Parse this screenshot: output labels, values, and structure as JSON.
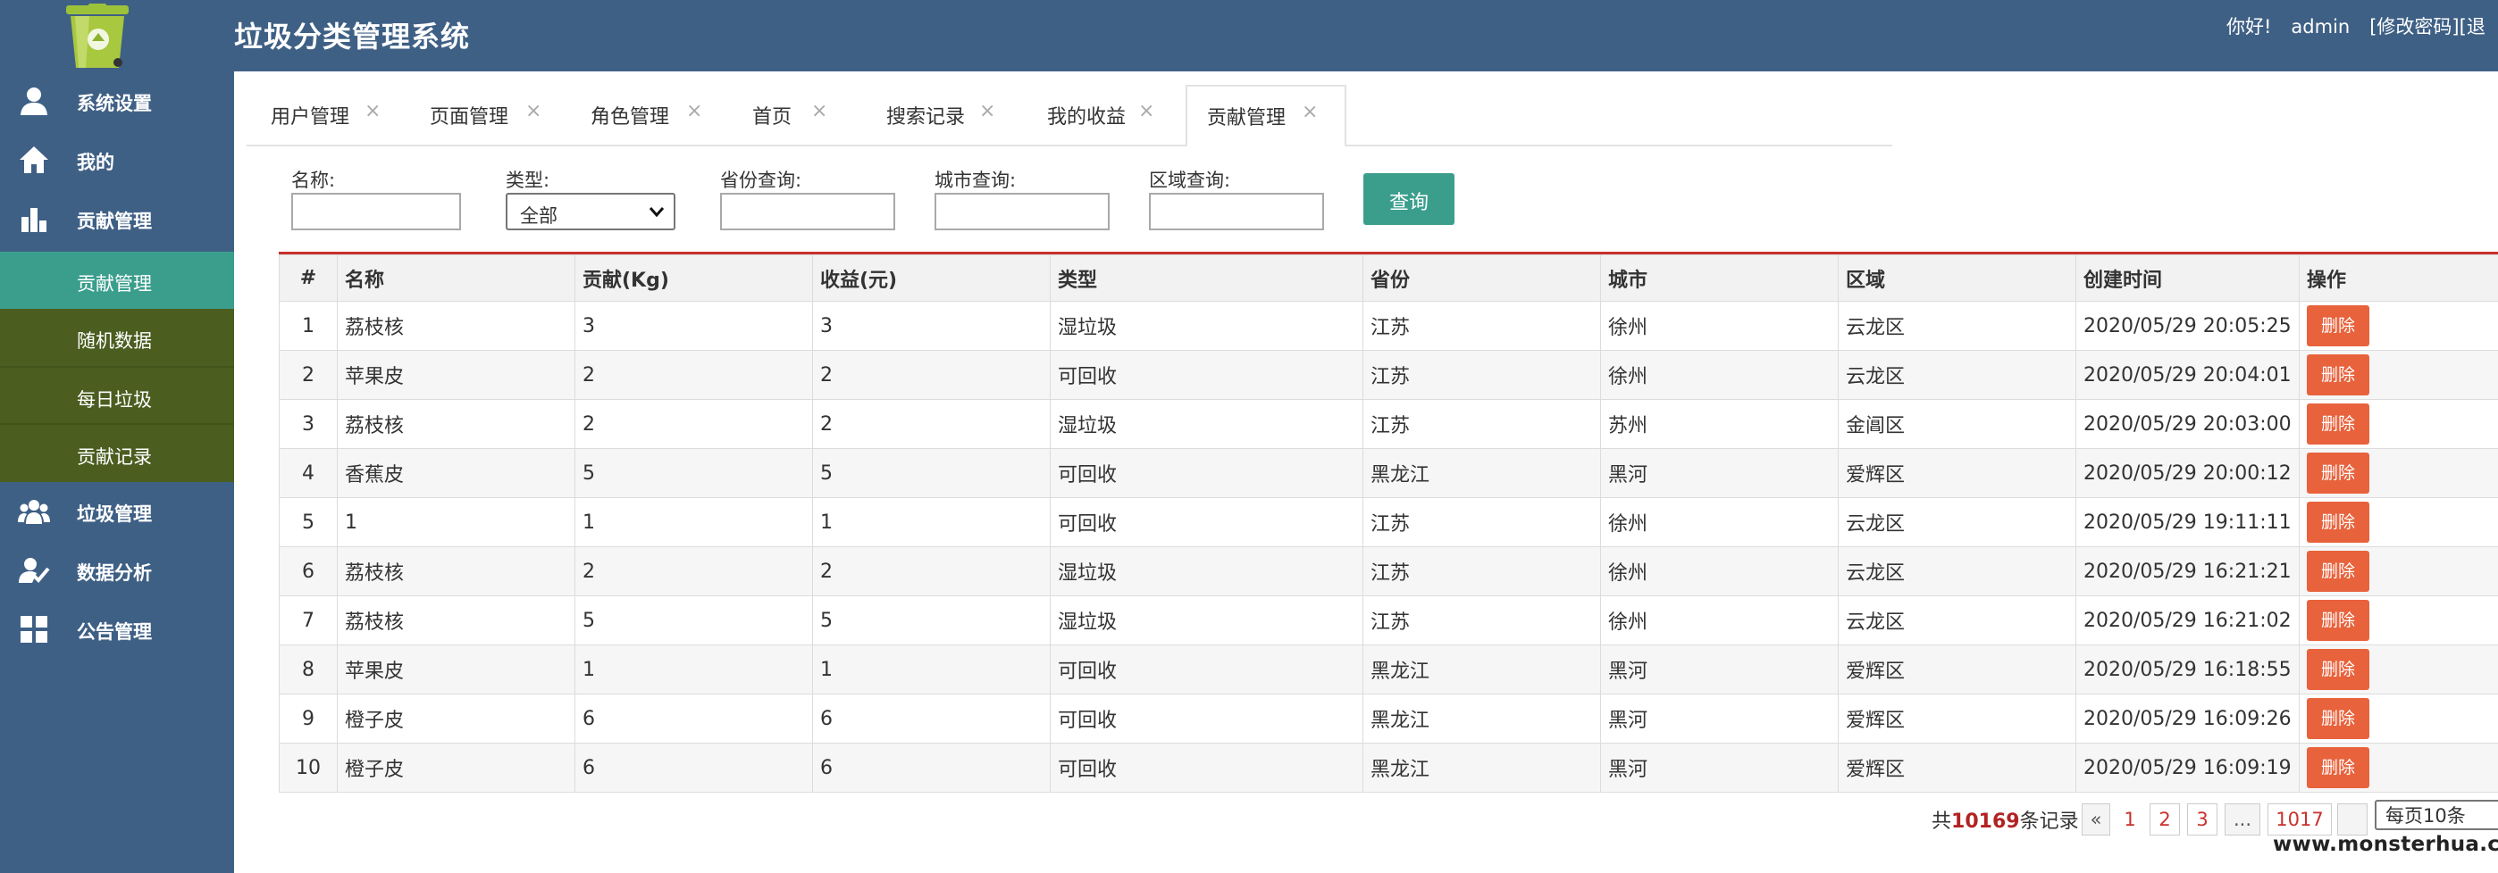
{
  "header": {
    "title": "垃圾分类管理系统",
    "greeting": "你好!",
    "username": "admin",
    "change_password": "[修改密码]",
    "logout": "[退"
  },
  "sidebar": {
    "items": [
      {
        "label": "系统设置",
        "icon": "user-icon"
      },
      {
        "label": "我的",
        "icon": "home-icon"
      },
      {
        "label": "贡献管理",
        "icon": "bar-chart-icon"
      },
      {
        "label": "垃圾管理",
        "icon": "group-icon"
      },
      {
        "label": "数据分析",
        "icon": "analysis-icon"
      },
      {
        "label": "公告管理",
        "icon": "grid-icon"
      }
    ],
    "subitems": [
      {
        "label": "贡献管理",
        "active": true
      },
      {
        "label": "随机数据"
      },
      {
        "label": "每日垃圾"
      },
      {
        "label": "贡献记录"
      }
    ],
    "active_color": "#3b9e8d",
    "sub_bg_color": "#4b5d1f"
  },
  "tabs": [
    {
      "label": "用户管理",
      "close": "×"
    },
    {
      "label": "页面管理",
      "close": "×"
    },
    {
      "label": "角色管理",
      "close": "×"
    },
    {
      "label": "首页",
      "close": "×"
    },
    {
      "label": "搜索记录",
      "close": "×"
    },
    {
      "label": "我的收益",
      "close": "×"
    },
    {
      "label": "贡献管理",
      "close": "×",
      "active": true
    }
  ],
  "search": {
    "name_label": "名称:",
    "name_value": "",
    "type_label": "类型:",
    "type_value": "全部",
    "province_label": "省份查询:",
    "province_value": "",
    "city_label": "城市查询:",
    "city_value": "",
    "district_label": "区域查询:",
    "district_value": "",
    "query_button": "查询"
  },
  "table": {
    "columns": [
      "#",
      "名称",
      "贡献(Kg)",
      "收益(元)",
      "类型",
      "省份",
      "城市",
      "区域",
      "创建时间",
      "操作"
    ],
    "delete_label": "删除",
    "rows": [
      [
        "1",
        "荔枝核",
        "3",
        "3",
        "湿垃圾",
        "江苏",
        "徐州",
        "云龙区",
        "2020/05/29 20:05:25"
      ],
      [
        "2",
        "苹果皮",
        "2",
        "2",
        "可回收",
        "江苏",
        "徐州",
        "云龙区",
        "2020/05/29 20:04:01"
      ],
      [
        "3",
        "荔枝核",
        "2",
        "2",
        "湿垃圾",
        "江苏",
        "苏州",
        "金阊区",
        "2020/05/29 20:03:00"
      ],
      [
        "4",
        "香蕉皮",
        "5",
        "5",
        "可回收",
        "黑龙江",
        "黑河",
        "爱辉区",
        "2020/05/29 20:00:12"
      ],
      [
        "5",
        "1",
        "1",
        "1",
        "可回收",
        "江苏",
        "徐州",
        "云龙区",
        "2020/05/29 19:11:11"
      ],
      [
        "6",
        "荔枝核",
        "2",
        "2",
        "湿垃圾",
        "江苏",
        "徐州",
        "云龙区",
        "2020/05/29 16:21:21"
      ],
      [
        "7",
        "荔枝核",
        "5",
        "5",
        "湿垃圾",
        "江苏",
        "徐州",
        "云龙区",
        "2020/05/29 16:21:02"
      ],
      [
        "8",
        "苹果皮",
        "1",
        "1",
        "可回收",
        "黑龙江",
        "黑河",
        "爱辉区",
        "2020/05/29 16:18:55"
      ],
      [
        "9",
        "橙子皮",
        "6",
        "6",
        "可回收",
        "黑龙江",
        "黑河",
        "爱辉区",
        "2020/05/29 16:09:26"
      ],
      [
        "10",
        "橙子皮",
        "6",
        "6",
        "可回收",
        "黑龙江",
        "黑河",
        "爱辉区",
        "2020/05/29 16:09:19"
      ]
    ]
  },
  "pagination": {
    "total_prefix": "共",
    "total_count": "10169",
    "total_suffix": "条记录",
    "prev": "«",
    "pages": [
      "1",
      "2",
      "3"
    ],
    "ellipsis": "...",
    "last_page": "1017",
    "per_page": "每页10条"
  },
  "watermark": "www.monsterhua.com"
}
